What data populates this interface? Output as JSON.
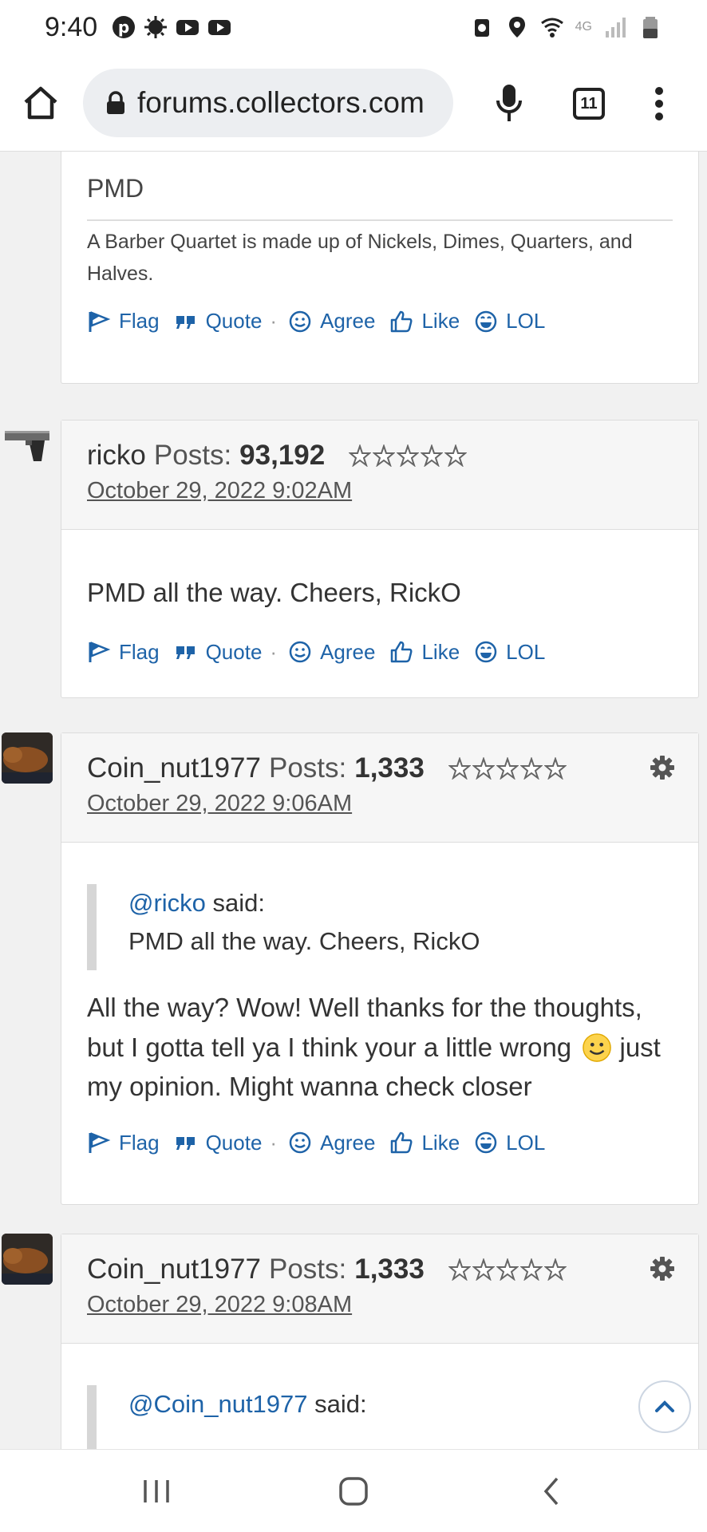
{
  "status_bar": {
    "time": "9:40",
    "left_icons": [
      "pinterest-icon",
      "settings-sun-icon",
      "youtube-icon",
      "youtube-icon"
    ],
    "right_icons": [
      "recycle-icon",
      "location-icon",
      "wifi-icon",
      "network-4g-icon",
      "signal-icon",
      "battery-icon"
    ],
    "network_label": "4G"
  },
  "browser": {
    "url": "forums.collectors.com",
    "tab_count": "11"
  },
  "posts": [
    {
      "signature_title": "PMD",
      "signature_text": "A Barber Quartet is made up of Nickels, Dimes, Quarters, and Halves."
    },
    {
      "author": "ricko",
      "posts_label": "Posts:",
      "posts_count": "93,192",
      "date": "October 29, 2022 9:02AM",
      "message": "PMD all the way. Cheers, RickO"
    },
    {
      "author": "Coin_nut1977",
      "posts_label": "Posts:",
      "posts_count": "1,333",
      "date": "October 29, 2022 9:06AM",
      "quote_mention": "@ricko",
      "quote_said": " said:",
      "quote_text": "PMD all the way. Cheers, RickO",
      "message_part1": "All the way? Wow! Well thanks for the thoughts, but I gotta tell ya I think your a little wrong",
      "message_part2": "just my opinion. Might wanna check closer"
    },
    {
      "author": "Coin_nut1977",
      "posts_label": "Posts:",
      "posts_count": "1,333",
      "date": "October 29, 2022 9:08AM",
      "quote_mention": "@Coin_nut1977",
      "quote_said": " said:"
    }
  ],
  "actions": {
    "flag": "Flag",
    "quote": "Quote",
    "separator": "·",
    "agree": "Agree",
    "like": "Like",
    "lol": "LOL"
  },
  "colors": {
    "link": "#1e63a8",
    "page_bg": "#f1f1f1",
    "card_header_bg": "#f6f6f6"
  }
}
